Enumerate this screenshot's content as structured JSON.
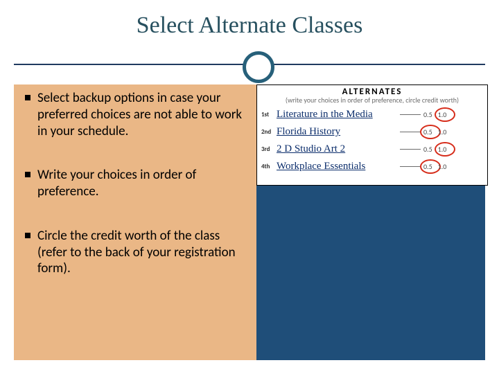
{
  "title": "Select Alternate Classes",
  "bullets": [
    "Select backup options in case your preferred choices are not able to work in your schedule.",
    "Write your choices in order of preference.",
    "Circle the credit worth of the class (refer to the back of your registration form)."
  ],
  "form": {
    "heading": "ALTERNATES",
    "subheading": "(write your choices in order of preference, circle credit worth)",
    "credit_options": [
      "0.5",
      "1.0"
    ],
    "rows": [
      {
        "ordinal": "1st",
        "course": "Literature in the Media",
        "circled": "1.0"
      },
      {
        "ordinal": "2nd",
        "course": "Florida History",
        "circled": "0.5"
      },
      {
        "ordinal": "3rd",
        "course": "2 D Studio Art 2",
        "circled": "1.0"
      },
      {
        "ordinal": "4th",
        "course": "Workplace Essentials",
        "circled": "0.5"
      }
    ]
  }
}
